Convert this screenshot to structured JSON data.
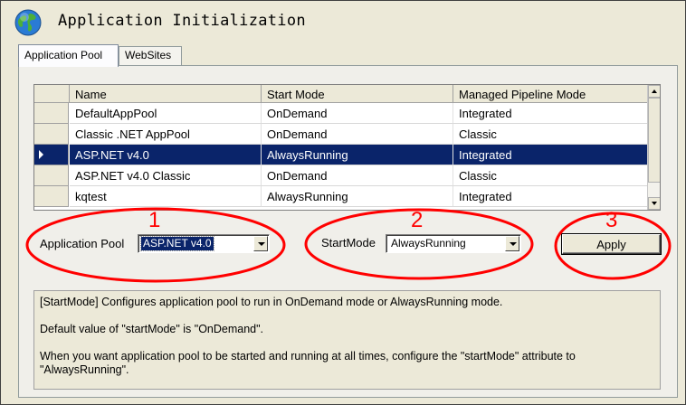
{
  "window": {
    "title": "Application Initialization",
    "icon": "globe-icon"
  },
  "tabs": [
    {
      "label": "Application Pool",
      "active": true
    },
    {
      "label": "WebSites",
      "active": false
    }
  ],
  "grid": {
    "columns": [
      "Name",
      "Start Mode",
      "Managed Pipeline Mode"
    ],
    "rows": [
      {
        "name": "DefaultAppPool",
        "start_mode": "OnDemand",
        "pipeline": "Integrated",
        "selected": false
      },
      {
        "name": "Classic .NET AppPool",
        "start_mode": "OnDemand",
        "pipeline": "Classic",
        "selected": false
      },
      {
        "name": "ASP.NET v4.0",
        "start_mode": "AlwaysRunning",
        "pipeline": "Integrated",
        "selected": true
      },
      {
        "name": "ASP.NET v4.0 Classic",
        "start_mode": "OnDemand",
        "pipeline": "Classic",
        "selected": false
      },
      {
        "name": "kqtest",
        "start_mode": "AlwaysRunning",
        "pipeline": "Integrated",
        "selected": false
      }
    ]
  },
  "controls": {
    "pool_label": "Application Pool",
    "pool_value": "ASP.NET v4.0",
    "startmode_label": "StartMode",
    "startmode_value": "AlwaysRunning",
    "apply_label": "Apply"
  },
  "annotations": [
    "1",
    "2",
    "3"
  ],
  "description": {
    "line1": "[StartMode] Configures application pool to run in OnDemand mode or AlwaysRunning mode.",
    "line2": "Default value of \"startMode\" is \"OnDemand\".",
    "line3": "When you want application pool to be started and running at all times, configure the \"startMode\" attribute to \"AlwaysRunning\"."
  },
  "colors": {
    "selection": "#0a246a",
    "annotation": "#ff0000",
    "face": "#ece9d8"
  }
}
